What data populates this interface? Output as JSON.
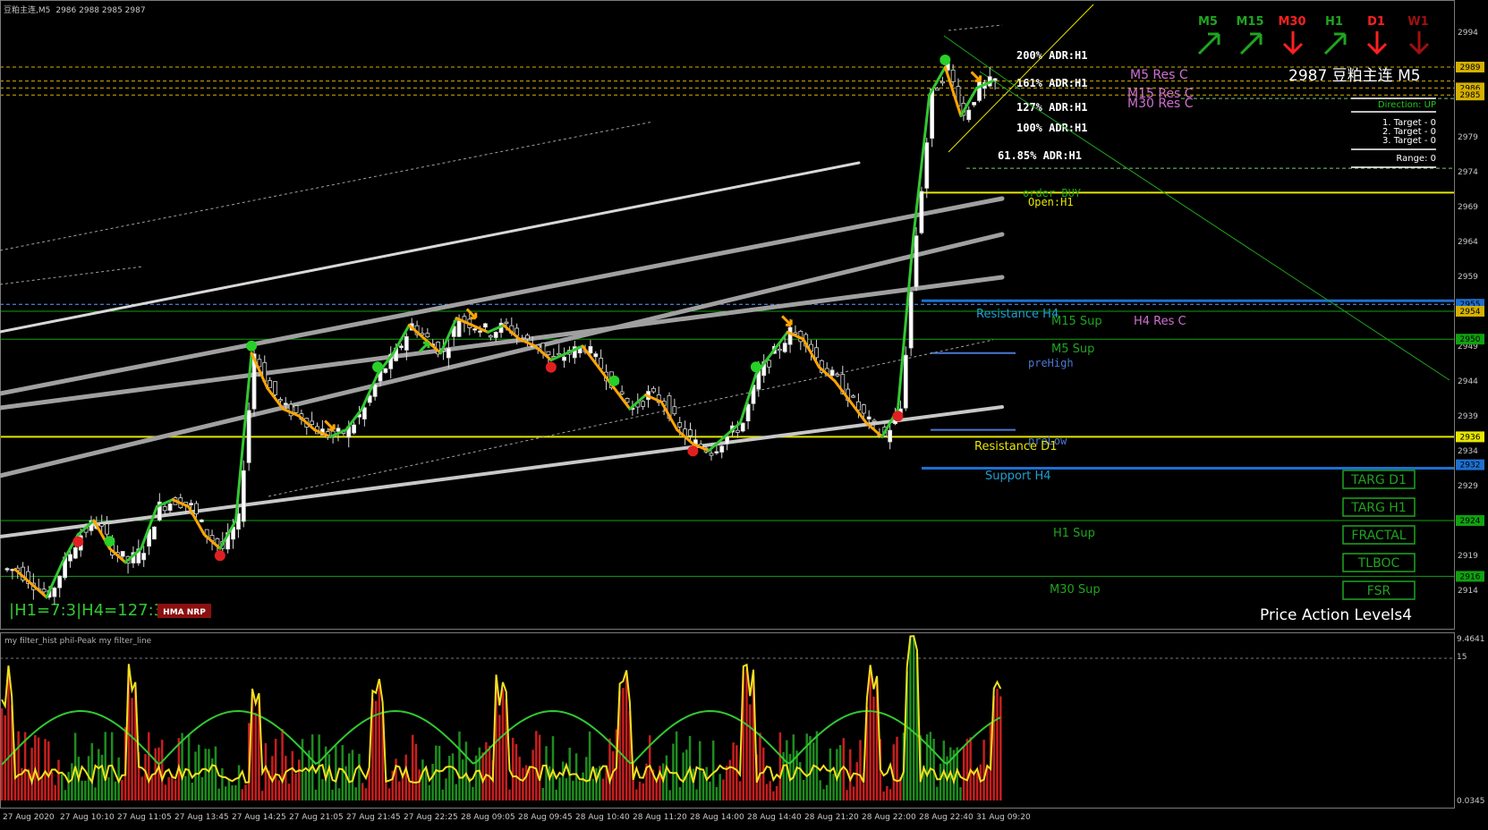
{
  "window": {
    "title": "豆粕主连,M5",
    "ohlc": "2986 2988 2985 2987"
  },
  "symbol_label": "2987 豆粕主连 M5",
  "timeframe_strip": [
    {
      "label": "M5",
      "direction": "up",
      "color": "#1fa51f"
    },
    {
      "label": "M15",
      "direction": "up",
      "color": "#1fa51f"
    },
    {
      "label": "M30",
      "direction": "down",
      "color": "#ff2020"
    },
    {
      "label": "H1",
      "direction": "up",
      "color": "#1fa51f"
    },
    {
      "label": "D1",
      "direction": "down",
      "color": "#ff2020"
    },
    {
      "label": "W1",
      "direction": "down",
      "color": "#a01010"
    }
  ],
  "info_panel": {
    "direction": "Direction: UP",
    "targets": [
      "1. Target - 0",
      "2. Target - 0",
      "3. Target - 0"
    ],
    "range": "Range: 0"
  },
  "adr_labels": [
    "200% ADR:H1",
    "161% ADR:H1",
    "127% ADR:H1",
    "100% ADR:H1",
    "61.85% ADR:H1"
  ],
  "level_labels": {
    "m5_res": "M5 Res C",
    "m15_res": "M15 Res C",
    "m30_res": "M30 Res C",
    "order": "order  BUY",
    "open_h1": "Open:H1",
    "resistance_h4": "Resistance H4",
    "m15_sup": "M15 Sup",
    "h4_res": "H4 Res C",
    "m5_sup": "M5 Sup",
    "pre_high": "preHigh",
    "pre_low": "preLow",
    "resistance_d1": "Resistance D1",
    "support_h4": "Support H4",
    "h1_sup": "H1 Sup",
    "m30_sup": "M30 Sup"
  },
  "buttons": [
    "TARG D1",
    "TARG H1",
    "FRACTAL",
    "TLBOC",
    "FSR"
  ],
  "bottom_text": {
    "ratio": "|H1=7:3|H4=127:3",
    "badge": "HMA NRP",
    "price_action": "Price Action Levels4"
  },
  "price_axis": {
    "ticks": [
      2994,
      2989,
      2985,
      2979,
      2974,
      2969,
      2964,
      2959,
      2954,
      2949,
      2944,
      2939,
      2934,
      2929,
      2924,
      2919,
      2914
    ],
    "markers": [
      {
        "value": 2989,
        "bg": "#d4b000"
      },
      {
        "value": 2986,
        "bg": "#d4b000"
      },
      {
        "value": 2985,
        "bg": "#d4b000"
      },
      {
        "value": 2955,
        "bg": "#1e6fd0"
      },
      {
        "value": 2954,
        "bg": "#d4b000"
      },
      {
        "value": 2950,
        "bg": "#10a010"
      },
      {
        "value": 2936,
        "bg": "#e6e600"
      },
      {
        "value": 2932,
        "bg": "#1e6fd0"
      },
      {
        "value": 2924,
        "bg": "#10a010"
      },
      {
        "value": 2916,
        "bg": "#10a010"
      }
    ]
  },
  "time_axis": [
    "27 Aug 2020",
    "27 Aug 10:10",
    "27 Aug 11:05",
    "27 Aug 13:45",
    "27 Aug 14:25",
    "27 Aug 21:05",
    "27 Aug 21:45",
    "27 Aug 22:25",
    "28 Aug 09:05",
    "28 Aug 09:45",
    "28 Aug 10:40",
    "28 Aug 11:20",
    "28 Aug 14:00",
    "28 Aug 14:40",
    "28 Aug 21:20",
    "28 Aug 22:00",
    "28 Aug 22:40",
    "31 Aug 09:20"
  ],
  "sub_window": {
    "title": "my filter_hist  phil-Peak  my filter_line",
    "axis_top": "9.4641",
    "axis_mid": "15",
    "axis_bottom": "0.0345"
  },
  "colors": {
    "up_line": "#32c832",
    "down_line": "#ffa500",
    "channel": "#a0a0a0",
    "yellow_level": "#e6e600",
    "blue_level": "#1e6fd0",
    "green_level": "#10a010"
  },
  "chart_data": {
    "type": "candlestick",
    "price_series": [
      2917,
      2915,
      2913,
      2918,
      2922,
      2924,
      2920,
      2918,
      2920,
      2926,
      2927,
      2926,
      2922,
      2920,
      2924,
      2948,
      2943,
      2940,
      2939,
      2937,
      2936,
      2937,
      2940,
      2945,
      2948,
      2952,
      2950,
      2948,
      2953,
      2952,
      2951,
      2952,
      2950,
      2949,
      2947,
      2948,
      2949,
      2946,
      2943,
      2940,
      2942,
      2941,
      2937,
      2935,
      2934,
      2936,
      2938,
      2945,
      2948,
      2951,
      2950,
      2946,
      2944,
      2941,
      2938,
      2936,
      2940,
      2965,
      2985,
      2989,
      2982,
      2986,
      2987
    ],
    "oscillator": {
      "series": [
        "my filter_hist",
        "phil-Peak",
        "my filter_line"
      ]
    }
  }
}
